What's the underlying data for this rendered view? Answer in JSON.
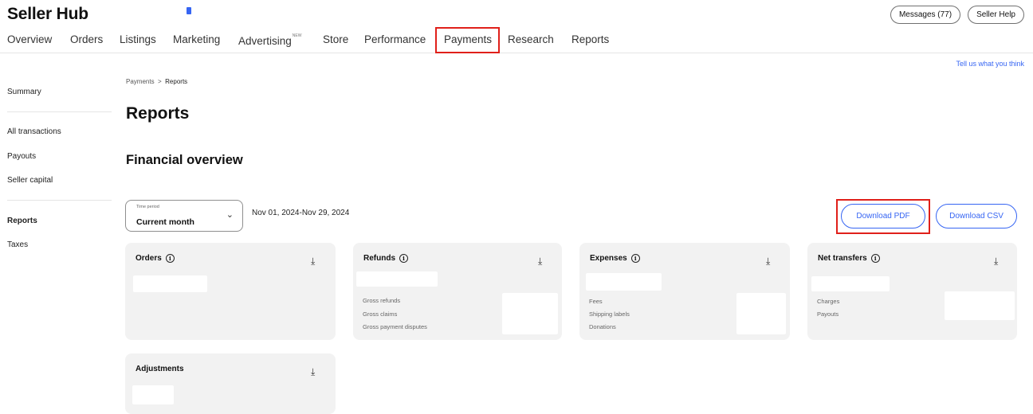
{
  "app": {
    "title": "Seller Hub"
  },
  "header": {
    "messages_label": "Messages (77)",
    "help_label": "Seller Help"
  },
  "nav": {
    "items": [
      {
        "label": "Overview"
      },
      {
        "label": "Orders"
      },
      {
        "label": "Listings"
      },
      {
        "label": "Marketing"
      },
      {
        "label": "Advertising",
        "badge": "NEW"
      },
      {
        "label": "Store"
      },
      {
        "label": "Performance"
      },
      {
        "label": "Payments",
        "active": true
      },
      {
        "label": "Research"
      },
      {
        "label": "Reports"
      }
    ]
  },
  "feedback_link": "Tell us what you think",
  "sidebar": {
    "items": [
      {
        "label": "Summary"
      },
      {
        "label": "All transactions"
      },
      {
        "label": "Payouts"
      },
      {
        "label": "Seller capital"
      },
      {
        "label": "Reports",
        "active": true
      },
      {
        "label": "Taxes"
      }
    ]
  },
  "breadcrumb": {
    "parent": "Payments",
    "separator": ">",
    "current": "Reports"
  },
  "page_title": "Reports",
  "section_title": "Financial overview",
  "period": {
    "label": "Time period",
    "value": "Current month",
    "date_range": "Nov 01, 2024-Nov 29, 2024"
  },
  "downloads": {
    "pdf_label": "Download PDF",
    "csv_label": "Download CSV"
  },
  "cards": {
    "orders": {
      "title": "Orders"
    },
    "refunds": {
      "title": "Refunds",
      "details": [
        "Gross refunds",
        "Gross claims",
        "Gross payment disputes"
      ]
    },
    "expenses": {
      "title": "Expenses",
      "details": [
        "Fees",
        "Shipping labels",
        "Donations"
      ]
    },
    "net_transfers": {
      "title": "Net transfers",
      "details": [
        "Charges",
        "Payouts"
      ]
    },
    "adjustments": {
      "title": "Adjustments"
    }
  },
  "colors": {
    "accent": "#3665f3",
    "highlight": "#e0201a",
    "card_bg": "#f2f2f2"
  },
  "icons": [
    "info-icon",
    "download-icon",
    "chevron-down-icon"
  ]
}
